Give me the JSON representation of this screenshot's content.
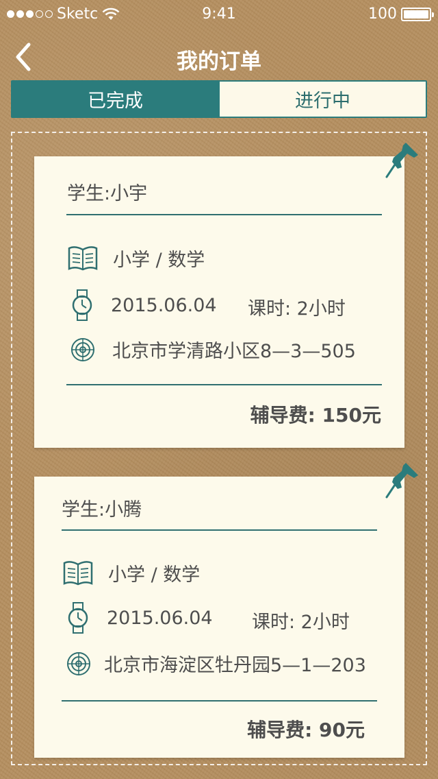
{
  "status_bar": {
    "carrier": "Sketc",
    "time": "9:41",
    "battery": "100",
    "battery_level": 1.0
  },
  "nav": {
    "title": "我的订单"
  },
  "tabs": [
    {
      "label": "已完成",
      "active": true
    },
    {
      "label": "进行中",
      "active": false
    }
  ],
  "colors": {
    "accent": "#2b7c7c",
    "background": "#b58f5f",
    "card": "#fdfaeb"
  },
  "orders": [
    {
      "student": "学生:小宇",
      "subject": "小学 / 数学",
      "date": "2015.06.04",
      "hours": "课时: 2小时",
      "address": "北京市学清路小区8—3—505",
      "fee": "辅导费:  150元"
    },
    {
      "student": "学生:小腾",
      "subject": "小学 / 数学",
      "date": "2015.06.04",
      "hours": "课时: 2小时",
      "address": "北京市海淀区牡丹园5—1—203",
      "fee": "辅导费:  90元"
    }
  ],
  "icons": {
    "book": "book-icon",
    "watch": "watch-icon",
    "location": "location-target-icon",
    "pin": "pushpin-icon",
    "back": "chevron-left-icon"
  }
}
